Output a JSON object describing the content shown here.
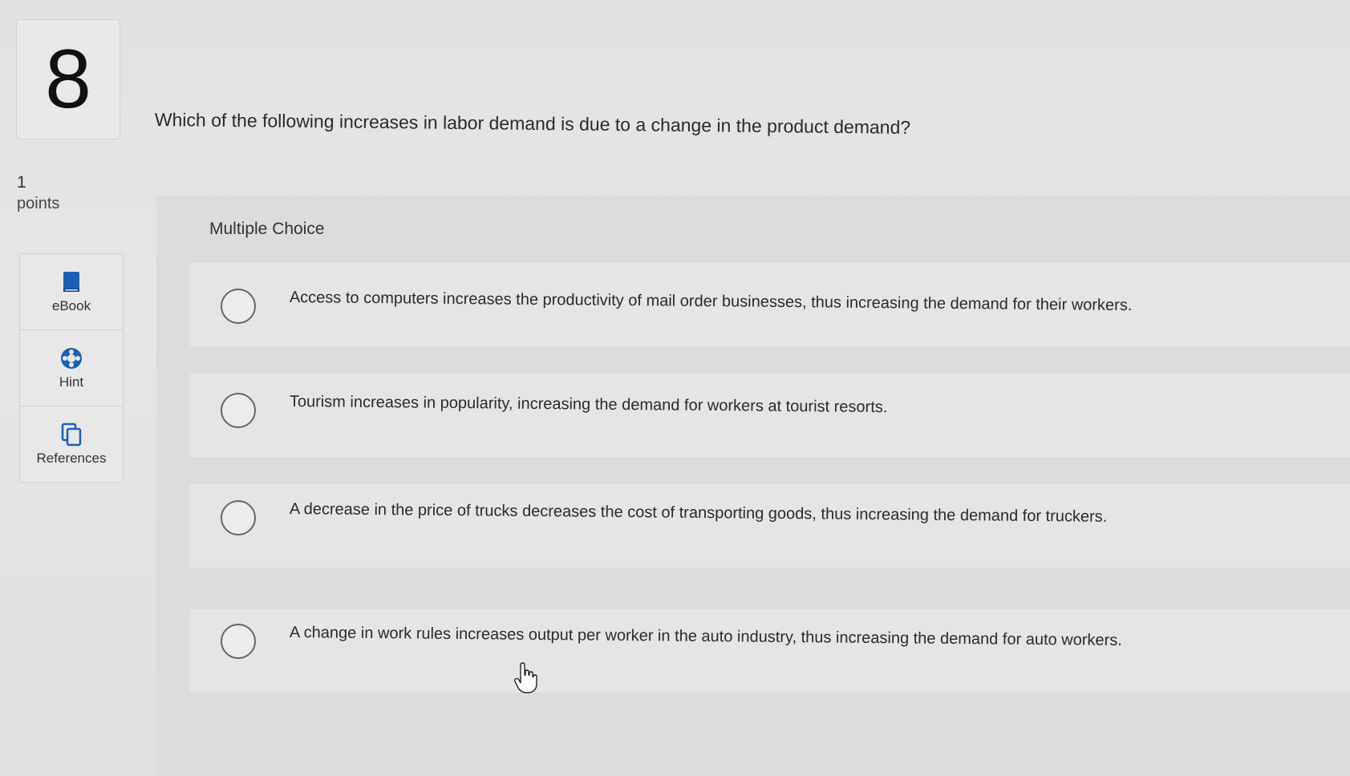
{
  "question": {
    "number": "8",
    "points_value": "1",
    "points_label": "points",
    "text": "Which of the following increases in labor demand is due to a change in the product demand?"
  },
  "tools": [
    {
      "label": "eBook",
      "icon": "book-icon"
    },
    {
      "label": "Hint",
      "icon": "lifebuoy-icon"
    },
    {
      "label": "References",
      "icon": "copy-pages-icon"
    }
  ],
  "answers": {
    "header": "Multiple Choice",
    "options": [
      {
        "text": "Access to computers increases the productivity of mail order businesses, thus increasing the demand for their workers."
      },
      {
        "text": "Tourism increases in popularity, increasing the demand for workers at tourist resorts."
      },
      {
        "text": "A decrease in the price of trucks decreases the cost of transporting goods, thus increasing the demand for truckers."
      },
      {
        "text": "A change in work rules increases output per worker in the auto industry, thus increasing the demand for auto workers."
      }
    ]
  },
  "colors": {
    "accent": "#1a5fb4",
    "radio_border": "#666666"
  }
}
